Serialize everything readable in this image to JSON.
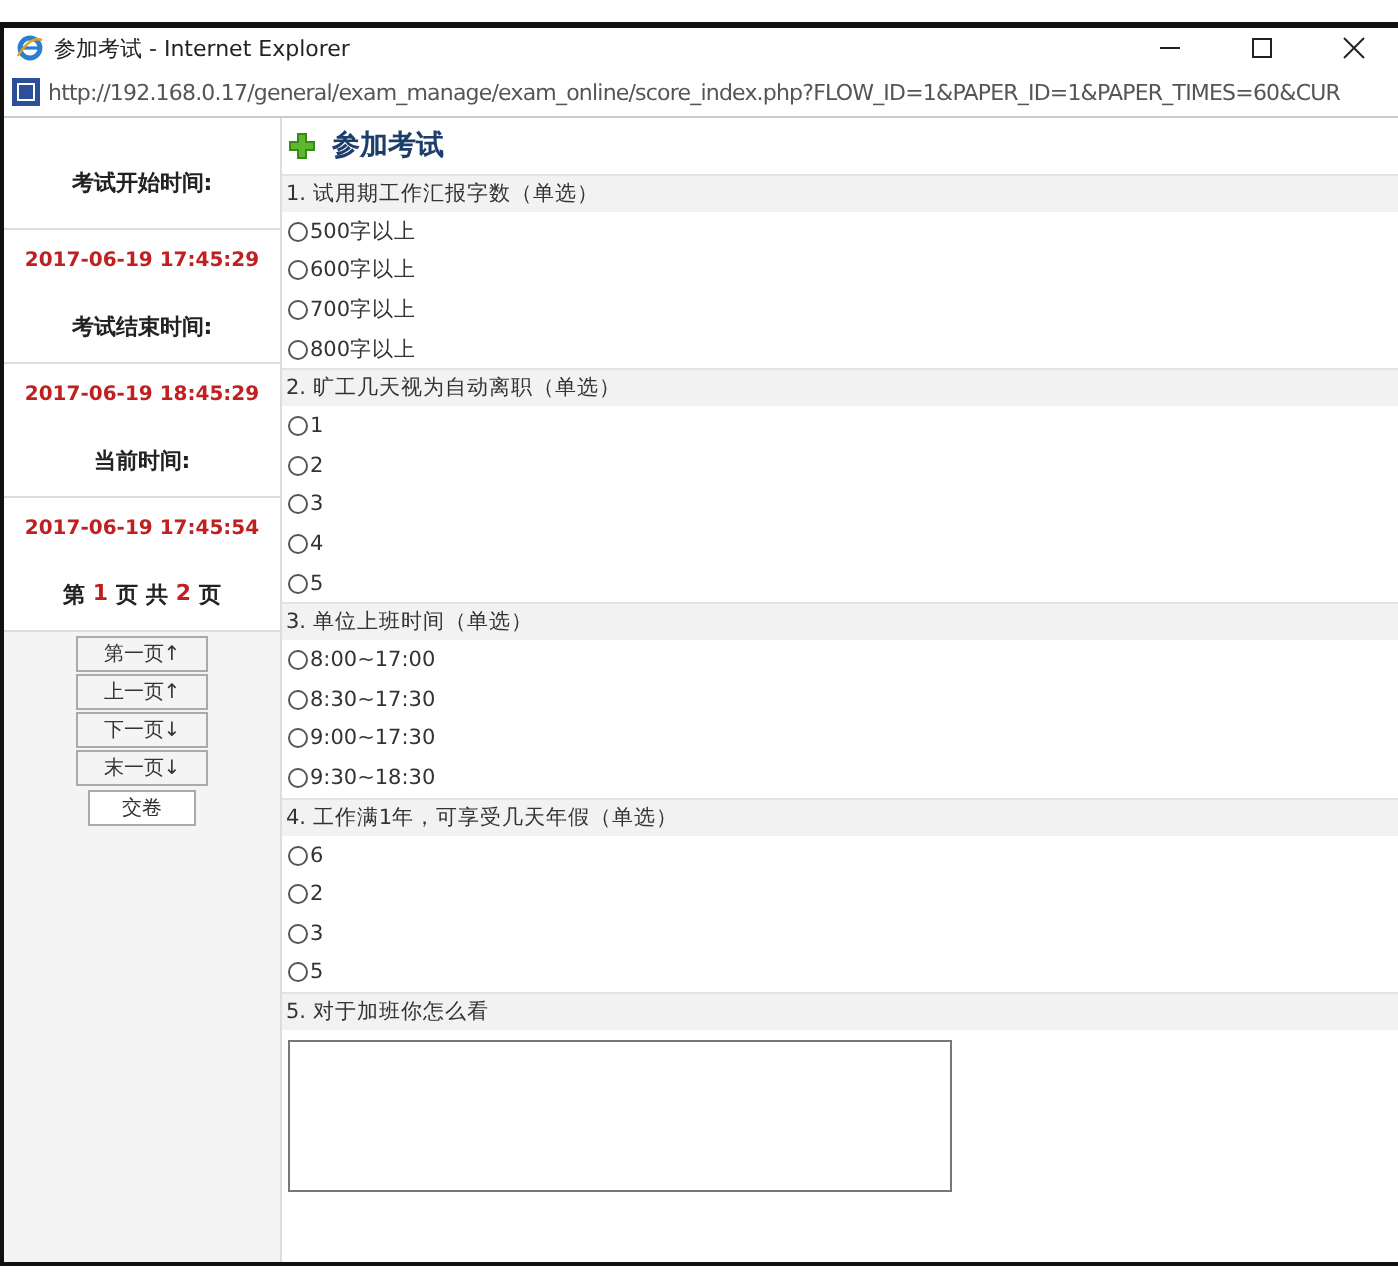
{
  "window": {
    "title": "参加考试 - Internet Explorer"
  },
  "address_bar": {
    "url": "http://192.168.0.17/general/exam_manage/exam_online/score_index.php?FLOW_ID=1&PAPER_ID=1&PAPER_TIMES=60&CUR"
  },
  "page_title": "参加考试",
  "sidebar": {
    "start_label": "考试开始时间:",
    "start_time": "2017-06-19 17:45:29",
    "end_label": "考试结束时间:",
    "end_time": "2017-06-19 18:45:29",
    "now_label": "当前时间:",
    "now_time": "2017-06-19 17:45:54",
    "pager": {
      "prefix": "第",
      "current": "1",
      "middle": "页 共",
      "total": "2",
      "suffix": "页"
    },
    "buttons": [
      "第一页↑",
      "上一页↑",
      "下一页↓",
      "末一页↓",
      "交卷"
    ]
  },
  "questions": [
    {
      "kind": "single",
      "title": "1. 试用期工作汇报字数（单选）",
      "options": [
        {
          "label": "500字以上",
          "selected": false
        },
        {
          "label": "600字以上",
          "selected": false
        },
        {
          "label": "700字以上",
          "selected": false
        },
        {
          "label": "800字以上",
          "selected": false
        }
      ]
    },
    {
      "kind": "single",
      "title": "2. 旷工几天视为自动离职（单选）",
      "options": [
        {
          "label": "1",
          "selected": false
        },
        {
          "label": "2",
          "selected": false
        },
        {
          "label": "3",
          "selected": false
        },
        {
          "label": "4",
          "selected": false
        },
        {
          "label": "5",
          "selected": false
        }
      ]
    },
    {
      "kind": "single",
      "title": "3. 单位上班时间（单选）",
      "options": [
        {
          "label": "8:00~17:00",
          "selected": false
        },
        {
          "label": "8:30~17:30",
          "selected": false
        },
        {
          "label": "9:00~17:30",
          "selected": false
        },
        {
          "label": "9:30~18:30",
          "selected": false
        }
      ]
    },
    {
      "kind": "single",
      "title": "4. 工作满1年，可享受几天年假（单选）",
      "options": [
        {
          "label": "6",
          "selected": false
        },
        {
          "label": "2",
          "selected": false
        },
        {
          "label": "3",
          "selected": false
        },
        {
          "label": "5",
          "selected": false
        }
      ]
    },
    {
      "kind": "text",
      "title": "5. 对于加班你怎么看"
    }
  ]
}
